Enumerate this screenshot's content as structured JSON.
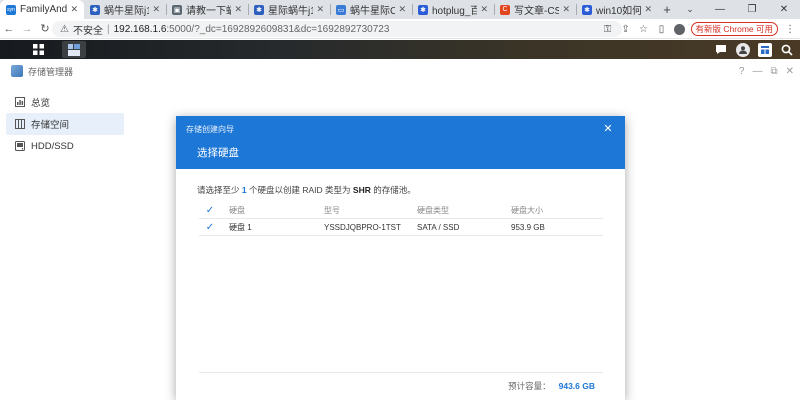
{
  "browser": {
    "tabs": [
      {
        "title": "FamilyAndLife",
        "favicon_color": "#1d77d6",
        "favicon_text": "syn",
        "active": true
      },
      {
        "title": "蜗牛星际j1900",
        "favicon_color": "#2d5fbf",
        "favicon_text": "✱",
        "active": false
      },
      {
        "title": "请教一下蜗牛星",
        "favicon_color": "#5b6770",
        "favicon_text": "▣",
        "active": false
      },
      {
        "title": "星际蜗牛j1900",
        "favicon_color": "#2d5fbf",
        "favicon_text": "✱",
        "active": false
      },
      {
        "title": "蜗牛星际C款绊",
        "favicon_color": "#3a7bd5",
        "favicon_text": "▭",
        "active": false
      },
      {
        "title": "hotplug_百度",
        "favicon_color": "#2b5bd7",
        "favicon_text": "✱",
        "active": false
      },
      {
        "title": "写文章-CSDN",
        "favicon_color": "#e2451e",
        "favicon_text": "C",
        "active": false
      },
      {
        "title": "win10如何截图",
        "favicon_color": "#2b5bd7",
        "favicon_text": "✱",
        "active": false
      }
    ],
    "new_tab": "+",
    "url": {
      "security": "不安全",
      "host": "192.168.1.6",
      "path": ":5000/?_dc=1692892609831&dc=1692892730723"
    },
    "update_button": "有新版 Chrome 可用"
  },
  "storage_manager": {
    "title": "存储管理器",
    "sidebar": [
      {
        "label": "总览",
        "icon": "overview-icon",
        "active": false
      },
      {
        "label": "存储空间",
        "icon": "storage-icon",
        "active": true
      },
      {
        "label": "HDD/SSD",
        "icon": "disk-icon",
        "active": false
      }
    ]
  },
  "wizard": {
    "title": "存储创建向导",
    "step_title": "选择硬盘",
    "desc_prefix": "请选择至少",
    "desc_count": "1",
    "desc_middle": "个硬盘以创建 RAID 类型为",
    "desc_raid": "SHR",
    "desc_suffix": "的存储池。",
    "columns": [
      "硬盘",
      "型号",
      "硬盘类型",
      "硬盘大小"
    ],
    "rows": [
      {
        "disk": "硬盘 1",
        "model": "YSSDJQBPRO-1TST",
        "type": "SATA / SSD",
        "size": "953.9 GB",
        "checked": true
      }
    ],
    "footer_label": "预计容量：",
    "footer_value": "943.6 GB"
  }
}
